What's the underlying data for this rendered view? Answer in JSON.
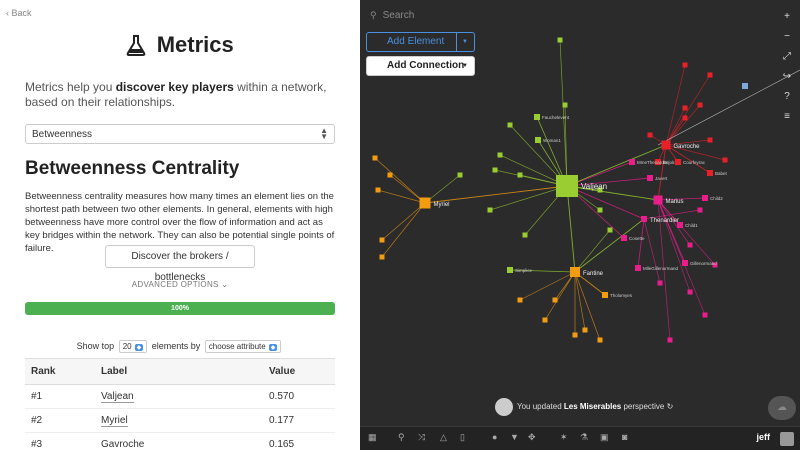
{
  "back_label": "Back",
  "title": "Metrics",
  "intro": {
    "before": "Metrics help you ",
    "bold": "discover key players",
    "after": " within a network, based on their relationships."
  },
  "metric_select": "Betweenness",
  "section_title": "Betweenness Centrality",
  "description": "Betweenness centrality measures how many times an element lies on the shortest path between two other elements. In general, elements with high betweenness have more control over the flow of information and act as key bridges within the network. They can also be potential single points of failure.",
  "discover_button": "Discover the brokers / bottlenecks",
  "advanced_options": "ADVANCED OPTIONS",
  "progress": {
    "percent": 100,
    "label": "100%"
  },
  "show_top": {
    "prefix": "Show top",
    "count": "20",
    "middle": "elements by",
    "attribute": "choose attribute"
  },
  "table": {
    "headers": [
      "Rank",
      "Label",
      "Value"
    ],
    "rows": [
      {
        "rank": "#1",
        "label": "Valjean",
        "value": "0.570"
      },
      {
        "rank": "#2",
        "label": "Myriel",
        "value": "0.177"
      },
      {
        "rank": "#3",
        "label": "Gavroche",
        "value": "0.165"
      }
    ]
  },
  "search_placeholder": "Search",
  "add_element": "Add Element",
  "add_connection": "Add Connection",
  "toast": {
    "before": "You updated ",
    "bold": "Les Miserables",
    "after": " perspective"
  },
  "user": "jeff",
  "colors": {
    "green": "#4caf50",
    "accent": "#4a90e2",
    "lime": "#9acd32",
    "orange": "#f39c12",
    "red": "#e8202a",
    "magenta": "#e91e8c"
  },
  "graph_labels": {
    "valjean": "Valjean",
    "myriel": "Myriel",
    "fantine": "Fantine",
    "marius": "Marius",
    "gavroche": "Gavroche",
    "thenardier": "Thenardier",
    "javert": "Javert",
    "enjolras": "Enjolras",
    "cosette": "Cosette",
    "tholomyes": "Tholomyes",
    "mme_thenardier": "MmeThenardier",
    "mlle_gillenormand": "MlleGillenormand",
    "gillenormand": "Gillenormand",
    "fauchelevent": "Fauchelevent",
    "simplice": "Simplice",
    "woman1": "Woman1",
    "child1": "Child1",
    "child2": "Child2",
    "babet": "Babet",
    "courfeyrac": "Courfeyrac"
  }
}
